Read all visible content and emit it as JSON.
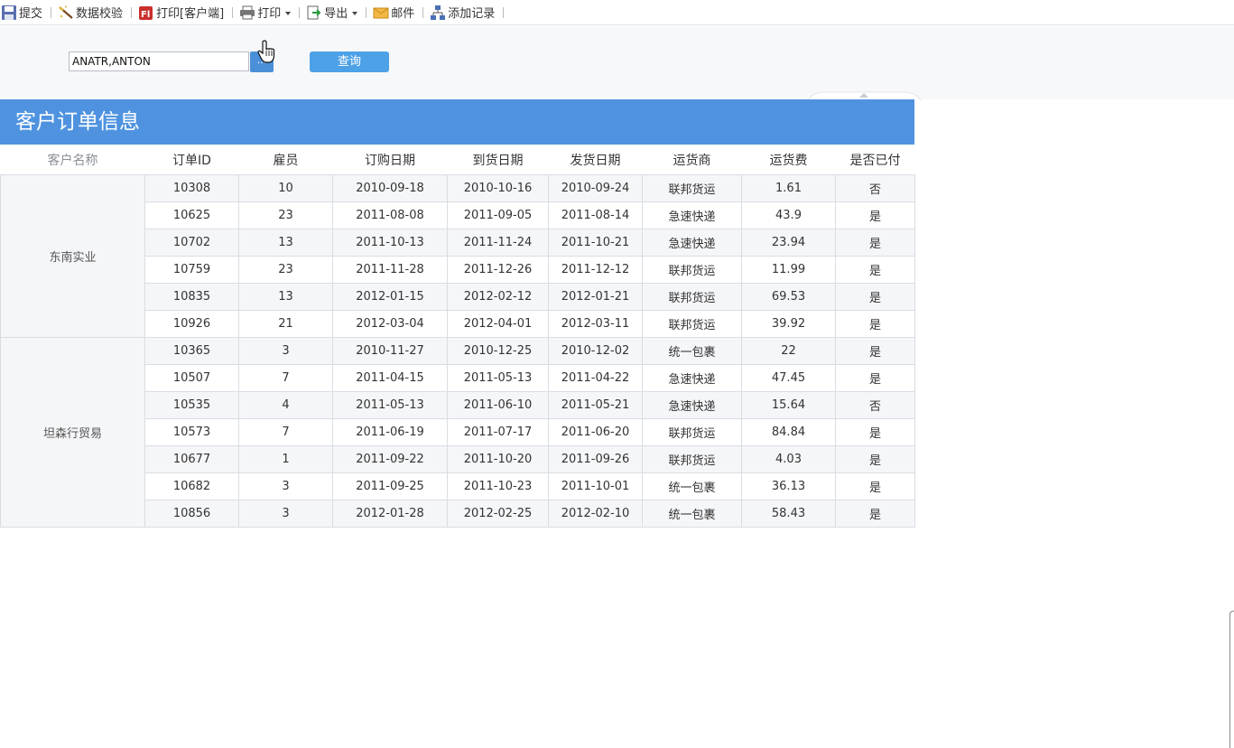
{
  "toolbar": {
    "items": [
      {
        "label": "提交",
        "icon": "save-icon"
      },
      {
        "label": "数据校验",
        "icon": "check-wand-icon"
      },
      {
        "label": "打印[客户端]",
        "icon": "flash-print-icon"
      },
      {
        "label": "打印",
        "icon": "printer-icon",
        "dropdown": true
      },
      {
        "label": "导出",
        "icon": "export-icon",
        "dropdown": true
      },
      {
        "label": "邮件",
        "icon": "mail-icon"
      },
      {
        "label": "添加记录",
        "icon": "add-record-icon"
      }
    ]
  },
  "params": {
    "customer_value": "ANATR,ANTON",
    "ellipsis_label": "...",
    "query_label": "查询"
  },
  "report": {
    "title": "客户订单信息",
    "columns": [
      "客户名称",
      "订单ID",
      "雇员",
      "订购日期",
      "到货日期",
      "发货日期",
      "运货商",
      "运货费",
      "是否已付"
    ],
    "groups": [
      {
        "customer": "东南实业",
        "rows": [
          [
            "10308",
            "10",
            "2010-09-18",
            "2010-10-16",
            "2010-09-24",
            "联邦货运",
            "1.61",
            "否"
          ],
          [
            "10625",
            "23",
            "2011-08-08",
            "2011-09-05",
            "2011-08-14",
            "急速快递",
            "43.9",
            "是"
          ],
          [
            "10702",
            "13",
            "2011-10-13",
            "2011-11-24",
            "2011-10-21",
            "急速快递",
            "23.94",
            "是"
          ],
          [
            "10759",
            "23",
            "2011-11-28",
            "2011-12-26",
            "2011-12-12",
            "联邦货运",
            "11.99",
            "是"
          ],
          [
            "10835",
            "13",
            "2012-01-15",
            "2012-02-12",
            "2012-01-21",
            "联邦货运",
            "69.53",
            "是"
          ],
          [
            "10926",
            "21",
            "2012-03-04",
            "2012-04-01",
            "2012-03-11",
            "联邦货运",
            "39.92",
            "是"
          ]
        ]
      },
      {
        "customer": "坦森行贸易",
        "rows": [
          [
            "10365",
            "3",
            "2010-11-27",
            "2010-12-25",
            "2010-12-02",
            "统一包裹",
            "22",
            "是"
          ],
          [
            "10507",
            "7",
            "2011-04-15",
            "2011-05-13",
            "2011-04-22",
            "急速快递",
            "47.45",
            "是"
          ],
          [
            "10535",
            "4",
            "2011-05-13",
            "2011-06-10",
            "2011-05-21",
            "急速快递",
            "15.64",
            "否"
          ],
          [
            "10573",
            "7",
            "2011-06-19",
            "2011-07-17",
            "2011-06-20",
            "联邦货运",
            "84.84",
            "是"
          ],
          [
            "10677",
            "1",
            "2011-09-22",
            "2011-10-20",
            "2011-09-26",
            "联邦货运",
            "4.03",
            "是"
          ],
          [
            "10682",
            "3",
            "2011-09-25",
            "2011-10-23",
            "2011-10-01",
            "统一包裹",
            "36.13",
            "是"
          ],
          [
            "10856",
            "3",
            "2012-01-28",
            "2012-02-25",
            "2012-02-10",
            "统一包裹",
            "58.43",
            "是"
          ]
        ]
      }
    ]
  },
  "colors": {
    "title_bar": "#4f93e0",
    "query_button": "#4da1e7",
    "ellipsis_button": "#4a90d9",
    "stripe": "#f5f6f8",
    "border": "#d9dde3"
  }
}
